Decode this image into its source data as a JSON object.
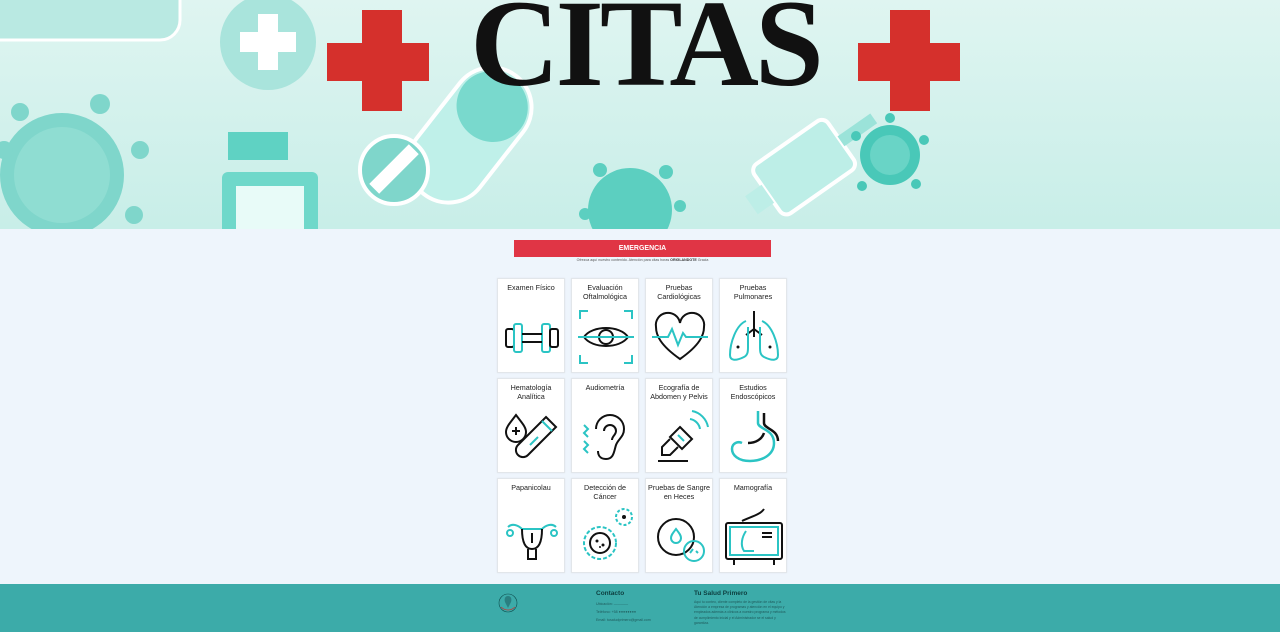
{
  "hero": {
    "title": "CITAS"
  },
  "emergency": {
    "button_label": "EMERGENCIA",
    "note_before": "Ofrezca aquí nuestro contenido. Atención para citas horas",
    "note_bold": "ORIGLANDOTE",
    "note_after": "Gracia"
  },
  "services": [
    {
      "label": "Examen Físico",
      "icon": "dumbbell-icon"
    },
    {
      "label": "Evaluación Oftalmológica",
      "icon": "eye-scan-icon"
    },
    {
      "label": "Pruebas Cardiológicas",
      "icon": "heart-pulse-icon"
    },
    {
      "label": "Pruebas Pulmonares",
      "icon": "lungs-icon"
    },
    {
      "label": "Hematología Analítica",
      "icon": "blood-test-icon"
    },
    {
      "label": "Audiometría",
      "icon": "ear-icon"
    },
    {
      "label": "Ecografía de Abdomen y Pelvis",
      "icon": "ultrasound-icon"
    },
    {
      "label": "Estudios Endoscópicos",
      "icon": "stomach-icon"
    },
    {
      "label": "Papanicolau",
      "icon": "uterus-icon"
    },
    {
      "label": "Detección de Cáncer",
      "icon": "cancer-cell-icon"
    },
    {
      "label": "Pruebas de Sangre en Heces",
      "icon": "stool-test-icon"
    },
    {
      "label": "Mamografía",
      "icon": "mammography-icon"
    }
  ],
  "footer": {
    "contact_title": "Contacto",
    "contact_lines": [
      "Ubicación: ————",
      "Teléfono: +58 ●●●●●●●●",
      "Email: tusaludprimero@gmail.com"
    ],
    "about_title": "Tu Salud Primero",
    "about_text": "Aquí tu conteo, cliente completo de la gestión de citas y la Atención a empresa de programas y atención en el equipo y empleados además a clinicos a nuestro programa y métodos de cumplimiento inicial y el Administrador se el salud y garantiza."
  },
  "colors": {
    "accent": "#e03545",
    "teal": "#3caba9",
    "icon_teal": "#2bc4c4",
    "hero_bg": "#cdeee9"
  }
}
